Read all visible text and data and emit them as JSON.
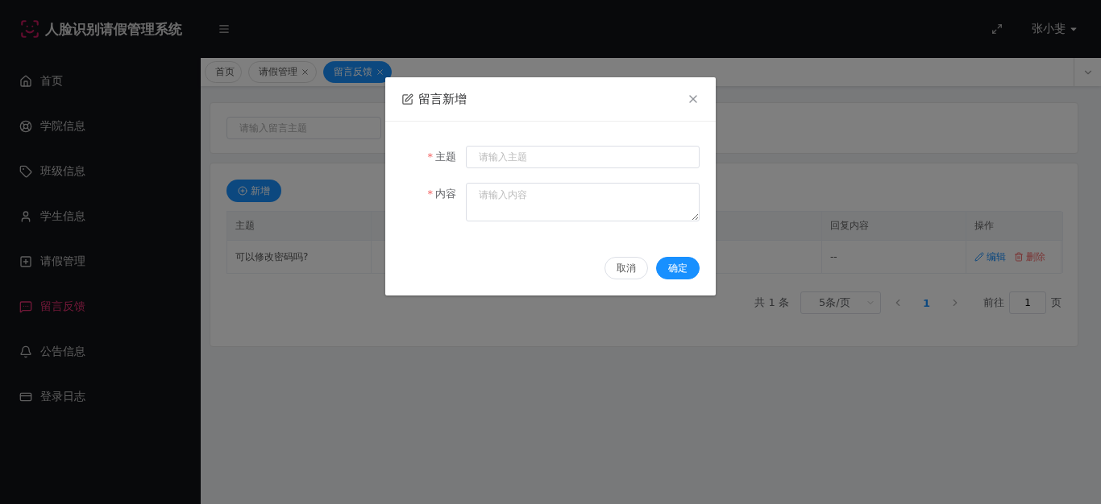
{
  "app": {
    "title": "人脸识别请假管理系统"
  },
  "header": {
    "user": "张小斐"
  },
  "sidebar": {
    "items": [
      {
        "label": "首页",
        "selected": false
      },
      {
        "label": "学院信息",
        "selected": false
      },
      {
        "label": "班级信息",
        "selected": false
      },
      {
        "label": "学生信息",
        "selected": false
      },
      {
        "label": "请假管理",
        "selected": false
      },
      {
        "label": "留言反馈",
        "selected": true
      },
      {
        "label": "公告信息",
        "selected": false
      },
      {
        "label": "登录日志",
        "selected": false
      }
    ]
  },
  "tabs": [
    {
      "label": "首页",
      "selected": false,
      "closable": false
    },
    {
      "label": "请假管理",
      "selected": false,
      "closable": true
    },
    {
      "label": "留言反馈",
      "selected": true,
      "closable": true
    }
  ],
  "search": {
    "placeholder": "请输入留言主题"
  },
  "add_button": "新增",
  "table": {
    "columns": [
      "主题",
      "回复内容",
      "操作"
    ],
    "rows": [
      {
        "subject": "可以修改密码吗?",
        "reply": "--",
        "actions": [
          {
            "label": "编辑",
            "kind": "edit"
          },
          {
            "label": "删除",
            "kind": "delete"
          }
        ]
      }
    ]
  },
  "pagination": {
    "total": "共 1 条",
    "page_size": "5条/页",
    "pages": [
      {
        "label": "1",
        "selected": true
      }
    ],
    "goto": "前往",
    "goto_value": "1",
    "suffix": "页"
  },
  "dialog": {
    "title": "留言新增",
    "required_mark": "*",
    "fields": [
      {
        "label": "主题",
        "placeholder": "请输入主题",
        "required": true,
        "kind": "input"
      },
      {
        "label": "内容",
        "placeholder": "请输入内容",
        "required": true,
        "kind": "textarea"
      }
    ],
    "buttons": [
      {
        "label": "取消",
        "kind": "default"
      },
      {
        "label": "确定",
        "kind": "primary"
      }
    ]
  }
}
